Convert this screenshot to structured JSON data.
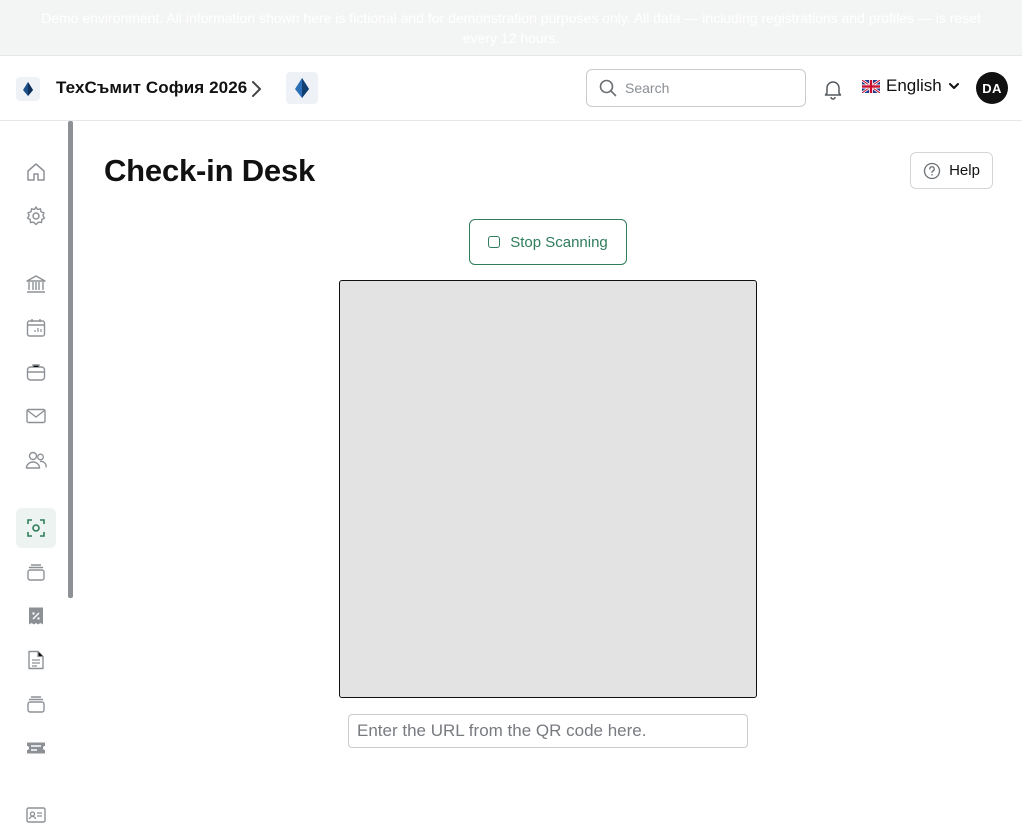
{
  "banner": {
    "text": "Demo environment. All information shown here is fictional and for demonstration purposes only. All data — including registrations and profiles — is reset every 12 hours."
  },
  "header": {
    "event_name": "ТехСъмит София 2026",
    "search_placeholder": "Search",
    "language": "English",
    "language_flag": "🇬🇧",
    "avatar_initials": "DA"
  },
  "sidebar": {
    "items": [
      {
        "icon": "home-icon"
      },
      {
        "icon": "settings-icon"
      },
      {
        "icon": "bank-icon"
      },
      {
        "icon": "calendar-icon"
      },
      {
        "icon": "briefcase-icon"
      },
      {
        "icon": "mail-icon"
      },
      {
        "icon": "users-icon"
      },
      {
        "icon": "scan-icon",
        "active": true
      },
      {
        "icon": "layers-icon"
      },
      {
        "icon": "discount-icon"
      },
      {
        "icon": "document-icon"
      },
      {
        "icon": "layers-icon"
      },
      {
        "icon": "ticket-icon"
      },
      {
        "icon": "id-card-icon"
      }
    ]
  },
  "main": {
    "title": "Check-in Desk",
    "help_label": "Help",
    "stop_scanning_label": "Stop Scanning",
    "url_placeholder": "Enter the URL from the QR code here."
  },
  "colors": {
    "accent": "#2e7d5b",
    "camera_bg": "#e3e3e4"
  }
}
